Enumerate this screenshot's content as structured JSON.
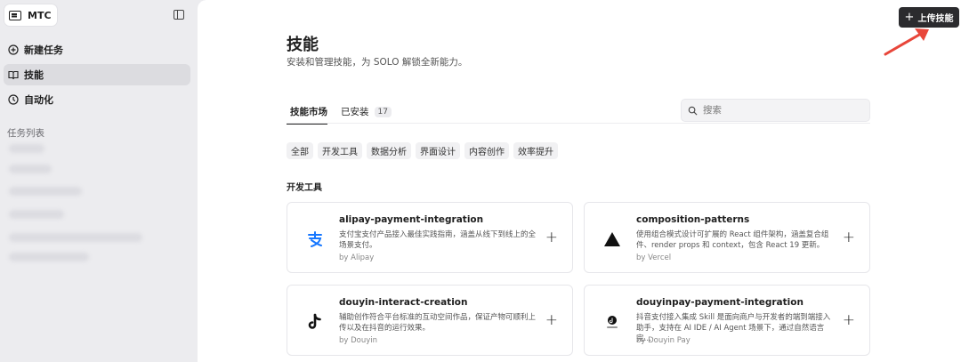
{
  "workspace": {
    "name": "MTC"
  },
  "sidebar": {
    "items": [
      {
        "label": "新建任务",
        "icon": "plus-circle-icon",
        "active": false
      },
      {
        "label": "技能",
        "icon": "book-icon",
        "active": true
      },
      {
        "label": "自动化",
        "icon": "clock-icon",
        "active": false
      }
    ],
    "task_list_label": "任务列表"
  },
  "header": {
    "title": "技能",
    "subtitle": "安装和管理技能，为 SOLO 解锁全新能力。",
    "upload_label": "上传技能"
  },
  "tabs": [
    {
      "label": "技能市场",
      "active": true
    },
    {
      "label": "已安装",
      "count": "17",
      "active": false
    }
  ],
  "search": {
    "placeholder": "搜索"
  },
  "filters": [
    "全部",
    "开发工具",
    "数据分析",
    "界面设计",
    "内容创作",
    "效率提升"
  ],
  "section": {
    "title": "开发工具"
  },
  "cards": [
    {
      "name": "alipay-payment-integration",
      "desc": "支付宝支付产品接入最佳实践指南，涵盖从线下到线上的全场景支付。",
      "by": "by Alipay",
      "icon": "alipay-icon"
    },
    {
      "name": "composition-patterns",
      "desc": "使用组合模式设计可扩展的 React 组件架构，涵盖复合组件、render props 和 context，包含 React 19 更新。",
      "by": "by Vercel",
      "icon": "vercel-triangle-icon"
    },
    {
      "name": "douyin-interact-creation",
      "desc": "辅助创作符合平台标准的互动空间作品，保证产物可顺利上传以及在抖音的运行效果。",
      "by": "by Douyin",
      "icon": "douyin-icon"
    },
    {
      "name": "douyinpay-payment-integration",
      "desc": "抖音支付接入集成 Skill 是面向商户与开发者的端到端接入助手，支持在 AI IDE / AI Agent 场景下，通过自然语言完…",
      "by": "by Douyin Pay",
      "icon": "douyinpay-icon"
    }
  ],
  "colors": {
    "accent_arrow": "#e8463a",
    "button_dark": "#2b2b2e",
    "alipay_blue": "#1677ff"
  }
}
